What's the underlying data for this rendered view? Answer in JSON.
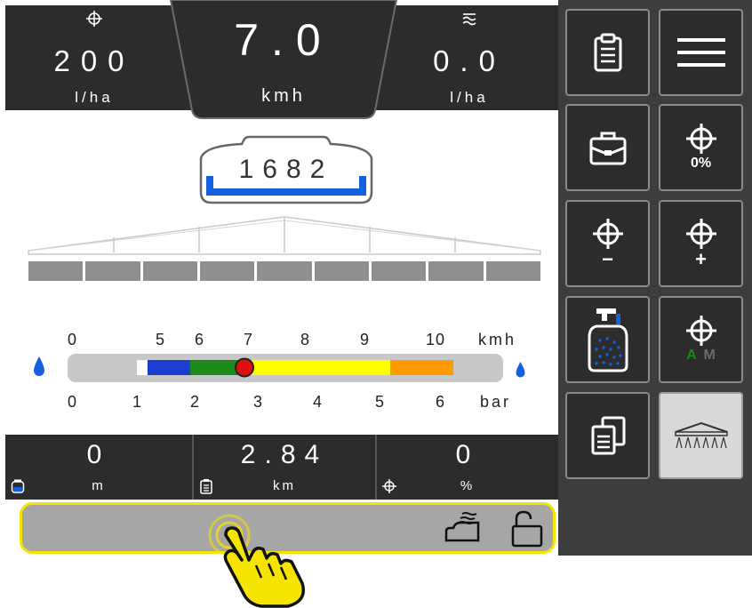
{
  "top": {
    "left": {
      "icon": "target-icon",
      "value": "200",
      "unit": "l/ha"
    },
    "speed": {
      "value": "7.0",
      "unit": "kmh"
    },
    "right": {
      "icon": "flow-icon",
      "value": "0.0",
      "unit": "l/ha"
    }
  },
  "tank": {
    "value": "1682"
  },
  "boom": {
    "section_count": 9
  },
  "scale": {
    "speed_ticks": [
      "0",
      "5",
      "6",
      "7",
      "8",
      "9",
      "10",
      "kmh"
    ],
    "pressure_ticks": [
      "0",
      "1",
      "2",
      "3",
      "4",
      "5",
      "6",
      "bar"
    ],
    "current_speed": 7.0
  },
  "bottom": {
    "left": {
      "icon": "tank-icon",
      "value": "0",
      "unit": "m"
    },
    "middle": {
      "icon": "clipboard-icon",
      "value": "2.84",
      "unit": "km"
    },
    "right": {
      "icon": "target-icon",
      "value": "0",
      "unit": "%"
    }
  },
  "status_bar": {
    "icons": [
      "agitation-icon",
      "unlock-icon"
    ]
  },
  "side_buttons": [
    {
      "name": "clipboard-button",
      "icon": "clipboard-icon",
      "label": ""
    },
    {
      "name": "menu-button",
      "icon": "hamburger-icon",
      "label": ""
    },
    {
      "name": "briefcase-button",
      "icon": "briefcase-icon",
      "label": ""
    },
    {
      "name": "rate-percent-button",
      "icon": "target-icon",
      "label": "0%"
    },
    {
      "name": "rate-minus-button",
      "icon": "target-icon",
      "label": "−"
    },
    {
      "name": "rate-plus-button",
      "icon": "target-icon",
      "label": "+"
    },
    {
      "name": "tank-fill-button",
      "icon": "tank-fill-icon",
      "label": ""
    },
    {
      "name": "auto-manual-button",
      "icon": "target-icon",
      "label_a": "A",
      "label_m": "M"
    },
    {
      "name": "copy-button",
      "icon": "copy-icon",
      "label": ""
    },
    {
      "name": "boom-button",
      "icon": "boom-icon",
      "label": ""
    }
  ],
  "colors": {
    "yellow": "#f5e400",
    "blue": "#1560e0",
    "dark": "#2c2c2c",
    "green": "#1a8a1a",
    "orange": "#ff9900",
    "red": "#e01010"
  }
}
